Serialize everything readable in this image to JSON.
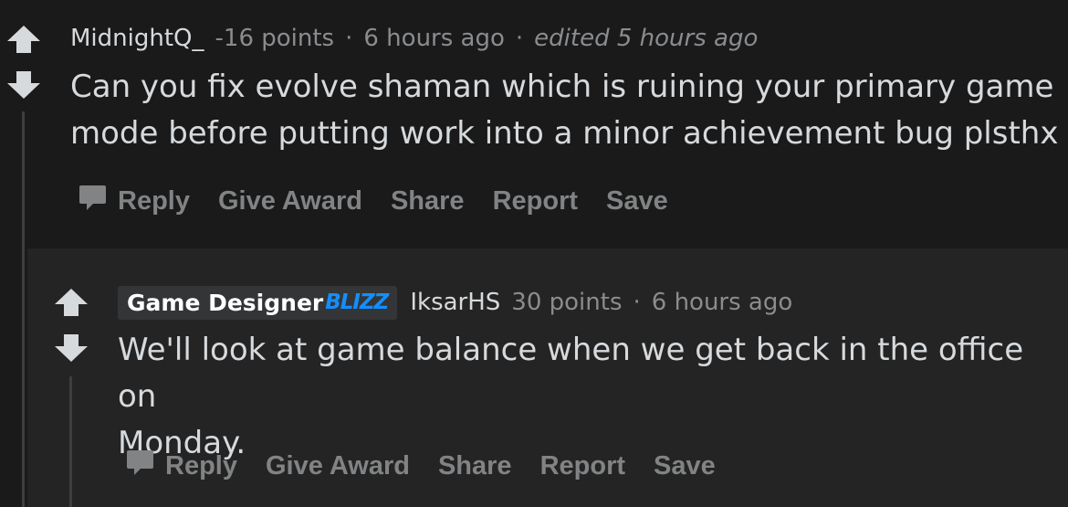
{
  "comment1": {
    "author": "MidnightQ_",
    "score": "-16 points",
    "time": "6 hours ago",
    "edited": "edited 5 hours ago",
    "body_line1": "Can you fix evolve shaman which is ruining your primary game",
    "body_line2": "mode before putting work into a minor achievement bug plsthx",
    "actions": {
      "reply": "Reply",
      "give_award": "Give Award",
      "share": "Share",
      "report": "Report",
      "save": "Save"
    }
  },
  "comment2": {
    "flair_text": "Game Designer",
    "flair_logo": "BLIZZ",
    "author": "IksarHS",
    "score": "30 points",
    "time": "6 hours ago",
    "body_line1": "We'll look at game balance when we get back in the office on",
    "body_line2": "Monday.",
    "actions": {
      "reply": "Reply",
      "give_award": "Give Award",
      "share": "Share",
      "report": "Report",
      "save": "Save"
    }
  },
  "separator": "·",
  "colors": {
    "background": "#1a1a1b",
    "reply_background": "#242425",
    "text": "#d7dadc",
    "muted": "#8a8c8e",
    "action": "#818384",
    "flair_bg": "#343536",
    "blizzard_blue": "#148eff"
  },
  "icons": [
    "upvote-icon",
    "downvote-icon",
    "comment-reply-icon"
  ]
}
